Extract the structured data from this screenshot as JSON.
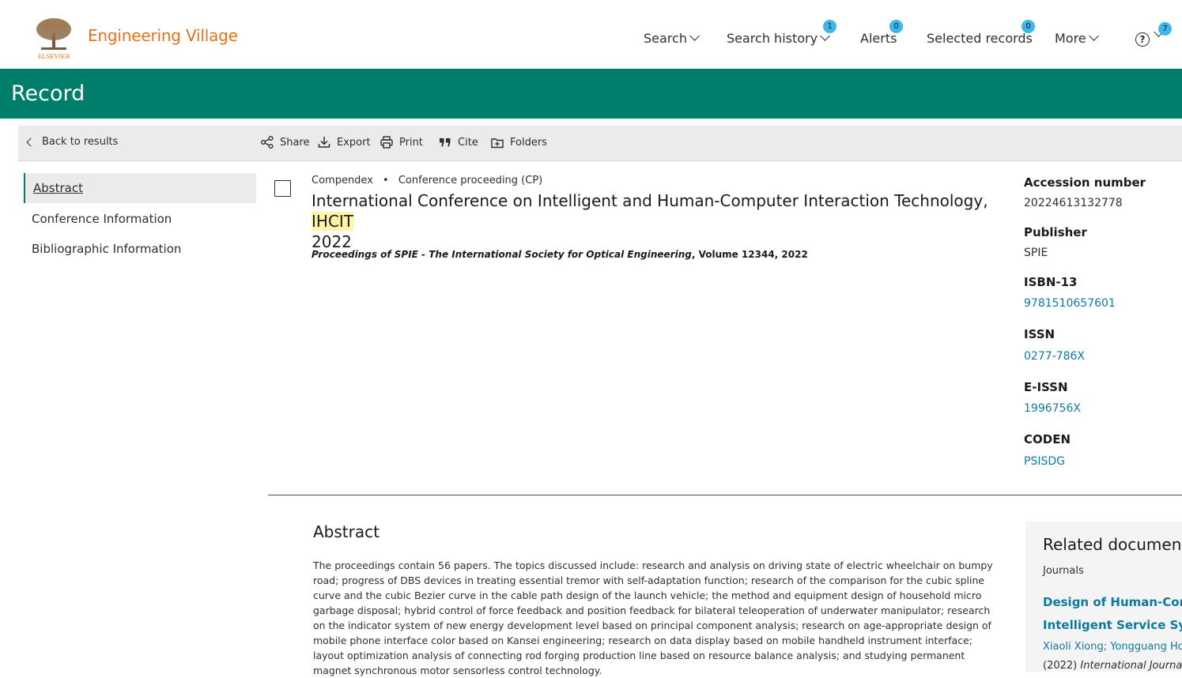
{
  "header": {
    "logo_text": "ELSEVIER",
    "brand": "Engineering Village",
    "nav": {
      "search": "Search",
      "search_history": "Search history",
      "search_history_count": "1",
      "alerts": "Alerts",
      "alerts_count": "0",
      "selected_records": "Selected records",
      "selected_count": "0",
      "more": "More",
      "help_glyph": "?",
      "help_count": "7"
    }
  },
  "banner": {
    "title": "Record"
  },
  "toolbar": {
    "back": "Back to results",
    "share": "Share",
    "export": "Export",
    "print": "Print",
    "cite": "Cite",
    "folders": "Folders"
  },
  "sidebar": {
    "items": [
      "Abstract",
      "Conference Information",
      "Bibliographic Information"
    ]
  },
  "record": {
    "database": "Compendex",
    "separator": "•",
    "doc_type": "Conference proceeding (CP)",
    "title_pre": "International Conference on Intelligent and Human-Computer Interaction Technology, ",
    "title_highlight": "IHCIT",
    "title_post": " 2022",
    "source_title": "Proceedings of SPIE - The International Society for Optical Engineering",
    "source_rest": ", Volume 12344, 2022"
  },
  "facts": {
    "accession_label": "Accession number",
    "accession_value": "20224613132778",
    "publisher_label": "Publisher",
    "publisher_value": "SPIE",
    "isbn_label": "ISBN-13",
    "isbn_value": "9781510657601",
    "issn_label": "ISSN",
    "issn_value": "0277-786X",
    "eissn_label": "E-ISSN",
    "eissn_value": "1996756X",
    "coden_label": "CODEN",
    "coden_value": "PSISDG"
  },
  "abstract": {
    "heading": "Abstract",
    "text": "The proceedings contain 56 papers. The topics discussed include: research and analysis on driving state of electric wheelchair on bumpy road; progress of DBS devices in treating essential tremor with self-adaptation function; research of the comparison for the cubic spline curve and the cubic Bezier curve in the cable path design of the launch vehicle; the method and equipment design of household micro garbage disposal; hybrid control of force feedback and position feedback for bilateral teleoperation of underwater manipulator; research on the indicator system of new energy development level based on principal component analysis; research on age-appropriate design of mobile phone interface color based on Kansei engineering; research on data display based on mobile handheld instrument interface; layout optimization analysis of connecting rod forging production line based on resource balance analysis; and studying permanent magnet synchronous motor sensorless control technology."
  },
  "related": {
    "heading": "Related documents",
    "category": "Journals",
    "doc_line1": "Design of Human-Computer",
    "doc_line2": "Intelligent Service System",
    "authors": "Xiaoli Xiong; Yongguang Hou",
    "source_year": "(2022) ",
    "source_journal": "International Journal of"
  },
  "colors": {
    "brand": "#e9711c",
    "banner": "#007e6b",
    "link": "#0c7aa0",
    "badge": "#3fb6ea",
    "highlight": "#fdf5a6"
  },
  "icons": [
    "elsevier-tree-logo",
    "chevron-down-icon",
    "help-circle-icon",
    "chevron-left-icon",
    "share-icon",
    "export-icon",
    "print-icon",
    "cite-icon",
    "folder-icon"
  ]
}
